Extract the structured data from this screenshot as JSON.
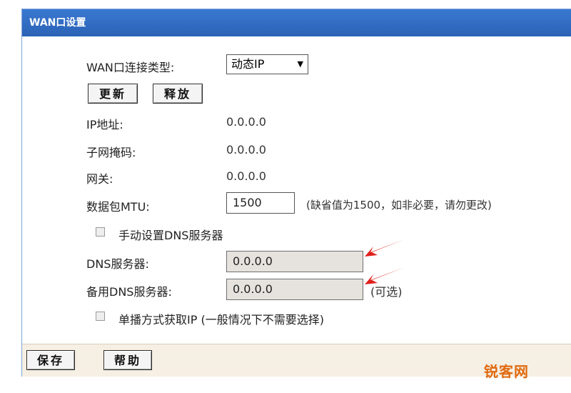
{
  "panel": {
    "title": "WAN口设置"
  },
  "form": {
    "conn_type_label": "WAN口连接类型:",
    "conn_type_value": "动态IP",
    "renew_label": "更新",
    "release_label": "释放",
    "ip_label": "IP地址:",
    "ip_value": "0.0.0.0",
    "mask_label": "子网掩码:",
    "mask_value": "0.0.0.0",
    "gateway_label": "网关:",
    "gateway_value": "0.0.0.0",
    "mtu_label": "数据包MTU:",
    "mtu_value": "1500",
    "mtu_hint": "(缺省值为1500，如非必要，请勿更改)",
    "manual_dns_label": "手动设置DNS服务器",
    "dns_label": "DNS服务器:",
    "dns_value": "0.0.0.0",
    "backup_dns_label": "备用DNS服务器:",
    "backup_dns_value": "0.0.0.0",
    "backup_dns_hint": "(可选)",
    "unicast_label": "单播方式获取IP (一般情况下不需要选择)"
  },
  "footer": {
    "save_label": "保存",
    "help_label": "帮助"
  },
  "watermark": {
    "text": "锐客网"
  },
  "colors": {
    "title_bar": "#2f6cc4",
    "footer_bg": "#f6efe3",
    "annotation_arrow": "#e0201c",
    "watermark": "#e06a10"
  }
}
